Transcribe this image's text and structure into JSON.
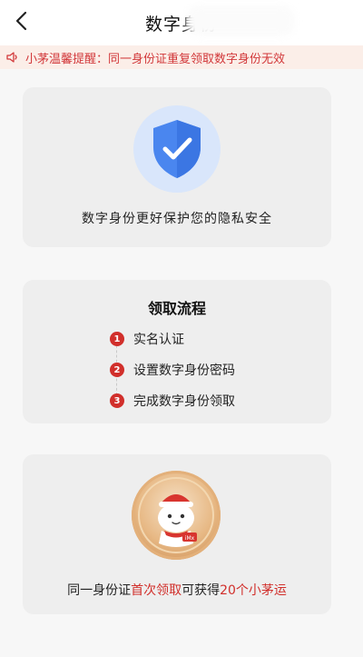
{
  "header": {
    "title": "数字身份"
  },
  "notice": {
    "text": "小茅温馨提醒：同一身份证重复领取数字身份无效"
  },
  "intro_card": {
    "caption": "数字身份更好保护您的隐私安全"
  },
  "process_card": {
    "heading": "领取流程",
    "steps": [
      {
        "num": "1",
        "label": "实名认证"
      },
      {
        "num": "2",
        "label": "设置数字身份密码"
      },
      {
        "num": "3",
        "label": "完成数字身份领取"
      }
    ]
  },
  "reward_card": {
    "part1": "同一身份证",
    "part2": "首次领取",
    "part3": "可获得",
    "part4": "20个小茅运",
    "badge_text": "iMx"
  },
  "colors": {
    "accent": "#d12f2b",
    "shield": "#4a86ef"
  },
  "icons": {
    "back": "chevron-left-icon",
    "speaker": "speaker-icon",
    "shield": "shield-check-icon",
    "mascot": "mascot-badge-icon"
  }
}
